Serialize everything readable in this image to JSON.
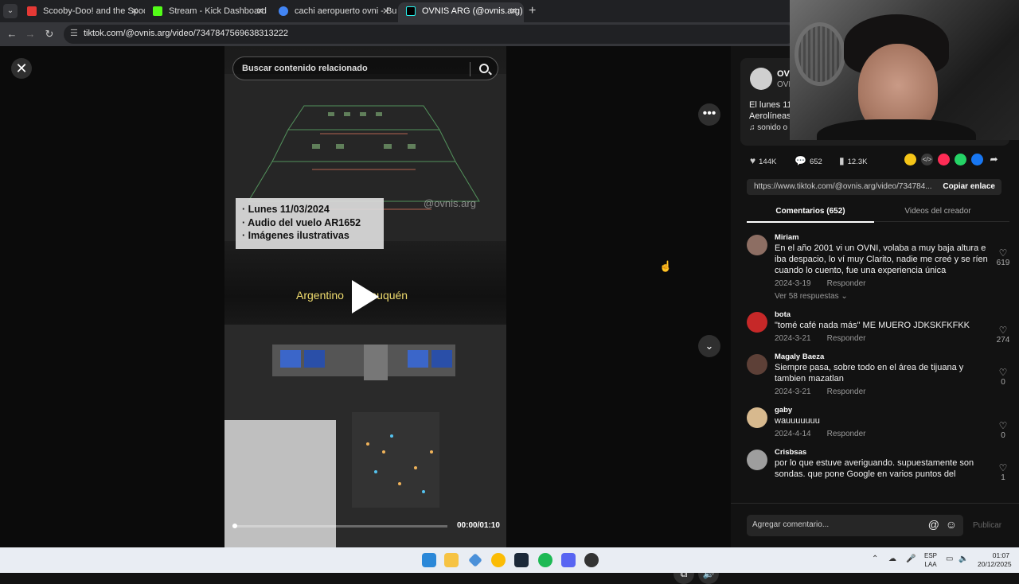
{
  "browser": {
    "tabs": [
      {
        "title": "Scooby-Doo! and the Spooky S",
        "favicon_color": "#e53935"
      },
      {
        "title": "Stream - Kick Dashboard",
        "favicon_color": "#53fc18"
      },
      {
        "title": "cachi aeropuerto ovni - Buscar",
        "favicon_color": "#4285f4"
      },
      {
        "title": "OVNIS ARG (@ovnis.arg) | TikTo",
        "favicon_color": "#000000"
      }
    ],
    "active_tab": 3,
    "url": "tiktok.com/@ovnis.arg/video/7347847569638313222"
  },
  "video": {
    "search_placeholder": "Buscar contenido relacionado",
    "overlay_lines": [
      "· Lunes 11/03/2024",
      "· Audio del vuelo AR1652",
      "· Imágenes ilustrativas"
    ],
    "watermark": "@ovnis.arg",
    "route_text": "Argentino      Neuquén",
    "time": "00:00/01:10",
    "progress": 0.0
  },
  "post": {
    "username": "OVNI",
    "handle": "OVN",
    "description_line1": "El lunes 11",
    "description_line2": "Aerolíneas",
    "music": "sonido o",
    "stats": {
      "likes": "144K",
      "comments": "652",
      "saves": "12.3K"
    },
    "link": "https://www.tiktok.com/@ovnis.arg/video/734784...",
    "copy_label": "Copiar enlace"
  },
  "panel_tabs": {
    "comments": "Comentarios (652)",
    "videos": "Videos del creador"
  },
  "comments": [
    {
      "name": "Miriam",
      "text": "En el año 2001 vi un OVNI, volaba a muy baja altura e iba despacio, lo ví muy Clarito, nadie me creé y se ríen cuando lo cuento, fue una experiencia única",
      "date": "2024-3-19",
      "reply": "Responder",
      "likes": "619",
      "more": "Ver 58 respuestas",
      "avatar_color": "#8d6e63"
    },
    {
      "name": "bota",
      "text": "\"tomé café nada más\" ME MUERO JDKSKFKFKK",
      "date": "2024-3-21",
      "reply": "Responder",
      "likes": "274",
      "more": "",
      "avatar_color": "#c62828"
    },
    {
      "name": "Magaly Baeza",
      "text": "Siempre pasa, sobre todo en el área de tijuana y tambien mazatlan",
      "date": "2024-3-21",
      "reply": "Responder",
      "likes": "0",
      "more": "",
      "avatar_color": "#5d4037"
    },
    {
      "name": "gaby",
      "text": "wauuuuuuu",
      "date": "2024-4-14",
      "reply": "Responder",
      "likes": "0",
      "more": "",
      "avatar_color": "#d7b98e"
    },
    {
      "name": "Crisbsas",
      "text": "por lo que estuve averiguando. supuestamente son sondas. que pone Google en varios puntos del",
      "date": "",
      "reply": "",
      "likes": "1",
      "more": "",
      "avatar_color": "#9e9e9e"
    }
  ],
  "add_comment": {
    "placeholder": "Agregar comentario...",
    "publish": "Publicar"
  },
  "taskbar": {
    "lang": "ESP",
    "lang2": "LAA",
    "time": "01:07",
    "date": "20/12/2025"
  }
}
